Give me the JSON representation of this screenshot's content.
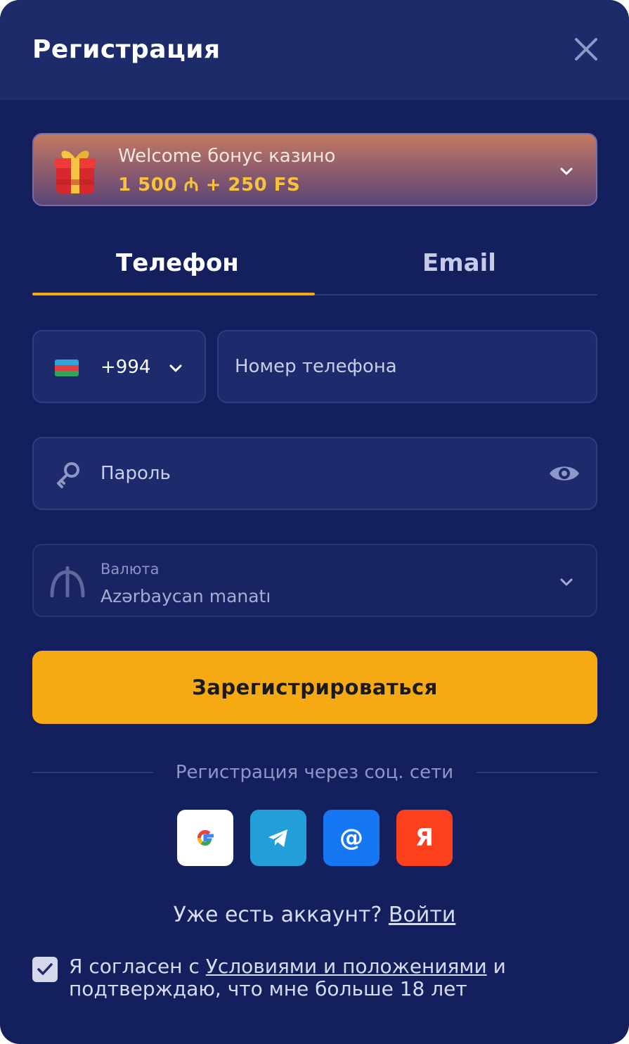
{
  "header": {
    "title": "Регистрация"
  },
  "bonus": {
    "label": "Welcome бонус казино",
    "amount": "1 500 ₼ + 250 FS"
  },
  "tabs": [
    {
      "label": "Телефон",
      "active": true
    },
    {
      "label": "Email",
      "active": false
    }
  ],
  "phone": {
    "country_code": "+994",
    "placeholder": "Номер телефона"
  },
  "password": {
    "placeholder": "Пароль"
  },
  "currency": {
    "label": "Валюта",
    "value": "Azərbaycan manatı"
  },
  "register_button": "Зарегистрироваться",
  "social": {
    "heading": "Регистрация через соц. сети",
    "providers": [
      "google-icon",
      "telegram-icon",
      "mail-ru-icon",
      "yandex-icon"
    ],
    "mail_glyph": "@",
    "yandex_glyph": "Я"
  },
  "login": {
    "prompt": "Уже есть аккаунт?",
    "link": "Войти"
  },
  "agreement": {
    "checked": true,
    "prefix": "Я согласен с",
    "link": "Условиями и положениями",
    "suffix": "и подтверждаю, что мне больше 18 лет"
  },
  "colors": {
    "background": "#141f5e",
    "accent": "#f5a913",
    "bonus_amount": "#f7c33c"
  }
}
